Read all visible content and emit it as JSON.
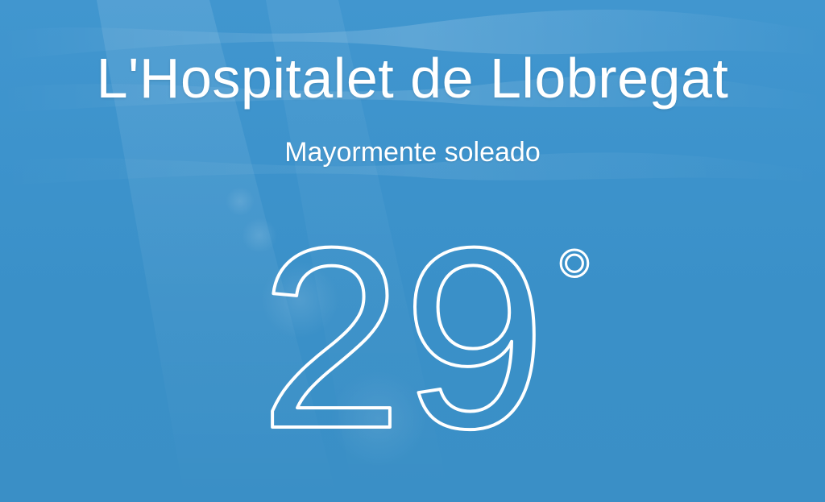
{
  "weather": {
    "city": "L'Hospitalet de Llobregat",
    "condition": "Mayormente soleado",
    "temperature": "29",
    "degree_symbol": "°"
  },
  "colors": {
    "background_top": "#4196cf",
    "background_bottom": "#3a8fc6",
    "text": "#ffffff"
  }
}
